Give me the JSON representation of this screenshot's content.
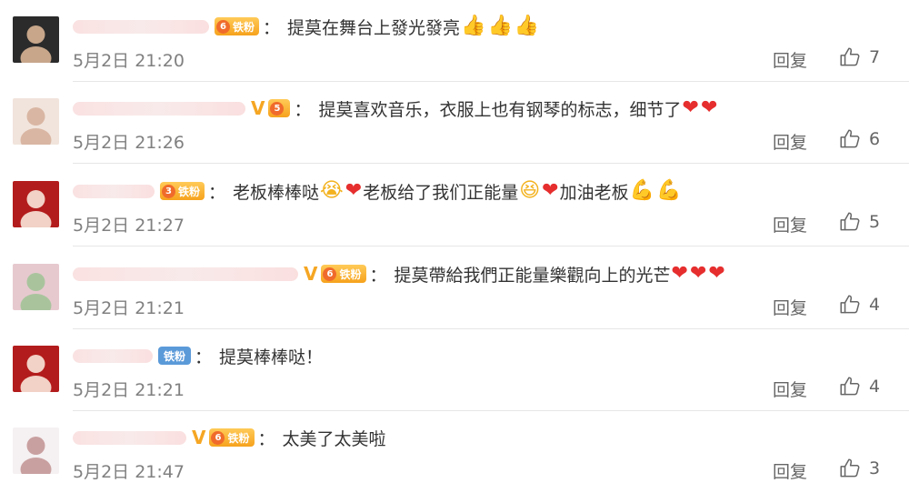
{
  "comments": [
    {
      "name_width": 150,
      "verified": false,
      "badge": {
        "type": "fan",
        "level": "6",
        "label": "铁粉"
      },
      "segments": [
        {
          "t": "text",
          "v": "提莫在舞台上發光發亮"
        },
        {
          "t": "emoji",
          "name": "thumbs-up",
          "v": "👍"
        },
        {
          "t": "emoji",
          "name": "thumbs-up",
          "v": "👍"
        },
        {
          "t": "emoji",
          "name": "thumbs-up",
          "v": "👍"
        }
      ],
      "time": "5月2日 21:20",
      "reply": "回复",
      "likes": "7"
    },
    {
      "name_width": 190,
      "verified": true,
      "badge": {
        "type": "level",
        "level": "5",
        "label": ""
      },
      "segments": [
        {
          "t": "text",
          "v": "提莫喜欢音乐，衣服上也有钢琴的标志，细节了"
        },
        {
          "t": "emoji",
          "name": "heart",
          "v": "❤"
        },
        {
          "t": "emoji",
          "name": "heart",
          "v": "❤"
        }
      ],
      "time": "5月2日 21:26",
      "reply": "回复",
      "likes": "6"
    },
    {
      "name_width": 90,
      "verified": false,
      "badge": {
        "type": "fan",
        "level": "3",
        "label": "铁粉"
      },
      "segments": [
        {
          "t": "text",
          "v": "老板棒棒哒"
        },
        {
          "t": "emoji",
          "name": "crying-face",
          "v": "😭"
        },
        {
          "t": "emoji",
          "name": "heart",
          "v": "❤"
        },
        {
          "t": "text",
          "v": "老板给了我们正能量"
        },
        {
          "t": "emoji",
          "name": "cheering-face",
          "v": "😆"
        },
        {
          "t": "emoji",
          "name": "heart",
          "v": "❤"
        },
        {
          "t": "text",
          "v": "加油老板"
        },
        {
          "t": "emoji",
          "name": "muscle",
          "v": "💪"
        },
        {
          "t": "emoji",
          "name": "muscle",
          "v": "💪"
        }
      ],
      "time": "5月2日 21:27",
      "reply": "回复",
      "likes": "5"
    },
    {
      "name_width": 248,
      "verified": true,
      "badge": {
        "type": "fan",
        "level": "6",
        "label": "铁粉"
      },
      "segments": [
        {
          "t": "text",
          "v": "提莫帶給我們正能量樂觀向上的光芒"
        },
        {
          "t": "emoji",
          "name": "heart",
          "v": "❤"
        },
        {
          "t": "emoji",
          "name": "heart",
          "v": "❤"
        },
        {
          "t": "emoji",
          "name": "heart",
          "v": "❤"
        }
      ],
      "time": "5月2日 21:21",
      "reply": "回复",
      "likes": "4"
    },
    {
      "name_width": 88,
      "verified": false,
      "badge": {
        "type": "plain",
        "level": "",
        "label": "铁粉"
      },
      "segments": [
        {
          "t": "text",
          "v": "提莫棒棒哒！"
        }
      ],
      "time": "5月2日 21:21",
      "reply": "回复",
      "likes": "4"
    },
    {
      "name_width": 125,
      "verified": true,
      "badge": {
        "type": "fan",
        "level": "6",
        "label": "铁粉"
      },
      "segments": [
        {
          "t": "text",
          "v": "太美了太美啦"
        }
      ],
      "time": "5月2日 21:47",
      "reply": "回复",
      "likes": "3"
    }
  ],
  "verified_mark": "V",
  "colors": {
    "badge_orange": "#f6a21d",
    "badge_blue": "#5b9ad9",
    "heart": "#e62e2e",
    "meta": "#808080"
  }
}
